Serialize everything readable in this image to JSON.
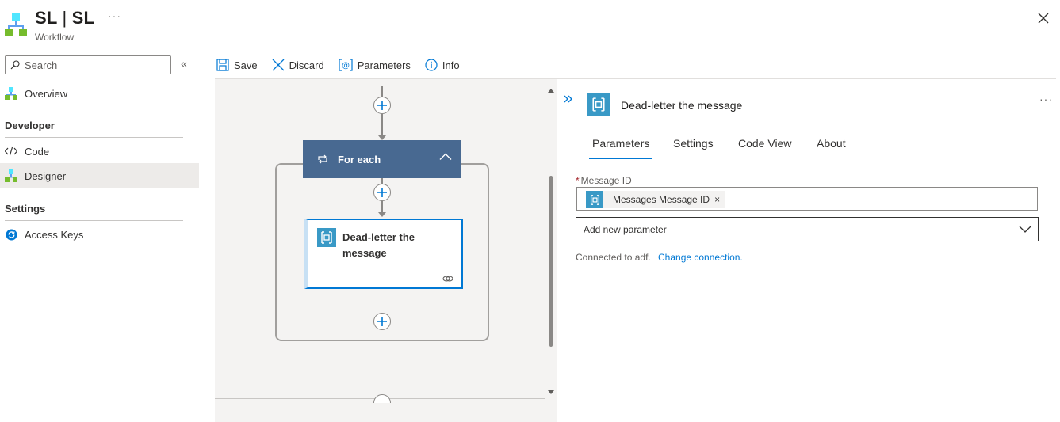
{
  "header": {
    "title_left": "SL",
    "title_sep": "|",
    "title_right": "SL",
    "subtitle": "Workflow",
    "more_label": "···",
    "icons": {
      "app": "workflow-app-icon",
      "close": "close-icon"
    }
  },
  "sidebar": {
    "search_placeholder": "Search",
    "collapse_label": "«",
    "items": [
      {
        "label": "Overview",
        "icon": "workflow-icon"
      },
      {
        "label": "Code",
        "icon": "code-icon"
      },
      {
        "label": "Designer",
        "icon": "designer-icon",
        "selected": true
      },
      {
        "label": "Access Keys",
        "icon": "refresh-key-icon"
      }
    ],
    "sections": {
      "developer": "Developer",
      "settings": "Settings"
    }
  },
  "toolbar": {
    "save_label": "Save",
    "discard_label": "Discard",
    "parameters_label": "Parameters",
    "info_label": "Info"
  },
  "canvas": {
    "foreach_title": "For each",
    "action_title": "Dead-letter the message"
  },
  "panel": {
    "title": "Dead-letter the message",
    "more_label": "···",
    "tabs": [
      {
        "label": "Parameters",
        "active": true
      },
      {
        "label": "Settings"
      },
      {
        "label": "Code View"
      },
      {
        "label": "About"
      }
    ],
    "message_id_required": "*",
    "message_id_label": "Message ID",
    "token_text": "Messages Message ID",
    "token_remove": "×",
    "add_parameter_placeholder": "Add new parameter",
    "connected_text": "Connected to adf.",
    "change_connection": "Change connection."
  },
  "colors": {
    "accent": "#0078d4",
    "foreach_header": "#486991",
    "servicebus_icon": "#3999c6",
    "selected_nav": "#edebe9"
  }
}
